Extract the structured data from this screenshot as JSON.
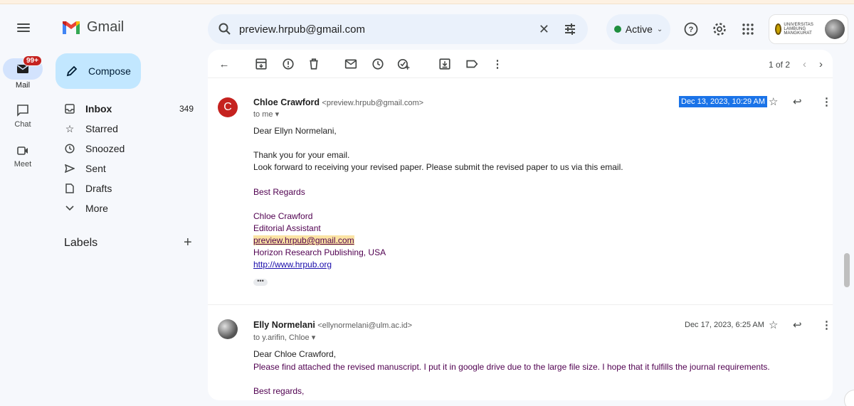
{
  "app": {
    "name": "Gmail"
  },
  "search": {
    "query": "preview.hrpub@gmail.com",
    "clear": "✕"
  },
  "status": {
    "label": "Active"
  },
  "rail": {
    "mail": {
      "label": "Mail",
      "badge": "99+"
    },
    "chat": {
      "label": "Chat"
    },
    "meet": {
      "label": "Meet"
    }
  },
  "sidebar": {
    "compose": "Compose",
    "items": [
      {
        "label": "Inbox",
        "count": "349",
        "icon": "inbox-icon"
      },
      {
        "label": "Starred",
        "icon": "star-icon"
      },
      {
        "label": "Snoozed",
        "icon": "clock-icon"
      },
      {
        "label": "Sent",
        "icon": "send-icon"
      },
      {
        "label": "Drafts",
        "icon": "draft-icon"
      },
      {
        "label": "More",
        "icon": "chevron-down-icon"
      }
    ],
    "labels_title": "Labels"
  },
  "account": {
    "org_text": "UNIVERSITAS LAMBUNG MANGKURAT"
  },
  "pager": {
    "text": "1 of 2"
  },
  "messages": [
    {
      "sender": "Chloe Crawford",
      "email": "<preview.hrpub@gmail.com>",
      "to": "to me",
      "date": "Dec 13, 2023, 10:29 AM",
      "avatar_letter": "C",
      "lines": [
        "Dear Ellyn Normelani,",
        "Thank you for your email.",
        "Look forward to receiving your revised paper. Please submit the revised paper to us via this email.",
        "Best Regards",
        "Chloe Crawford",
        "Editorial Assistant",
        "preview.hrpub@gmail.com",
        "Horizon Research Publishing, USA",
        "http://www.hrpub.org"
      ],
      "ellipsis": "•••"
    },
    {
      "sender": "Elly Normelani",
      "email": "<ellynormelani@ulm.ac.id>",
      "to": "to y.arifin, Chloe",
      "date": "Dec 17, 2023, 6:25 AM",
      "lines": [
        "Dear Chloe Crawford,",
        "Please find attached the revised manuscript. I put it in google drive due to the large file size. I hope that it fulfills the journal requirements.",
        "Best regards,"
      ]
    }
  ],
  "colors": {
    "accent": "#c2e7ff",
    "badge": "#c5221f",
    "selection": "#1a73e8",
    "purple_text": "#500050"
  }
}
